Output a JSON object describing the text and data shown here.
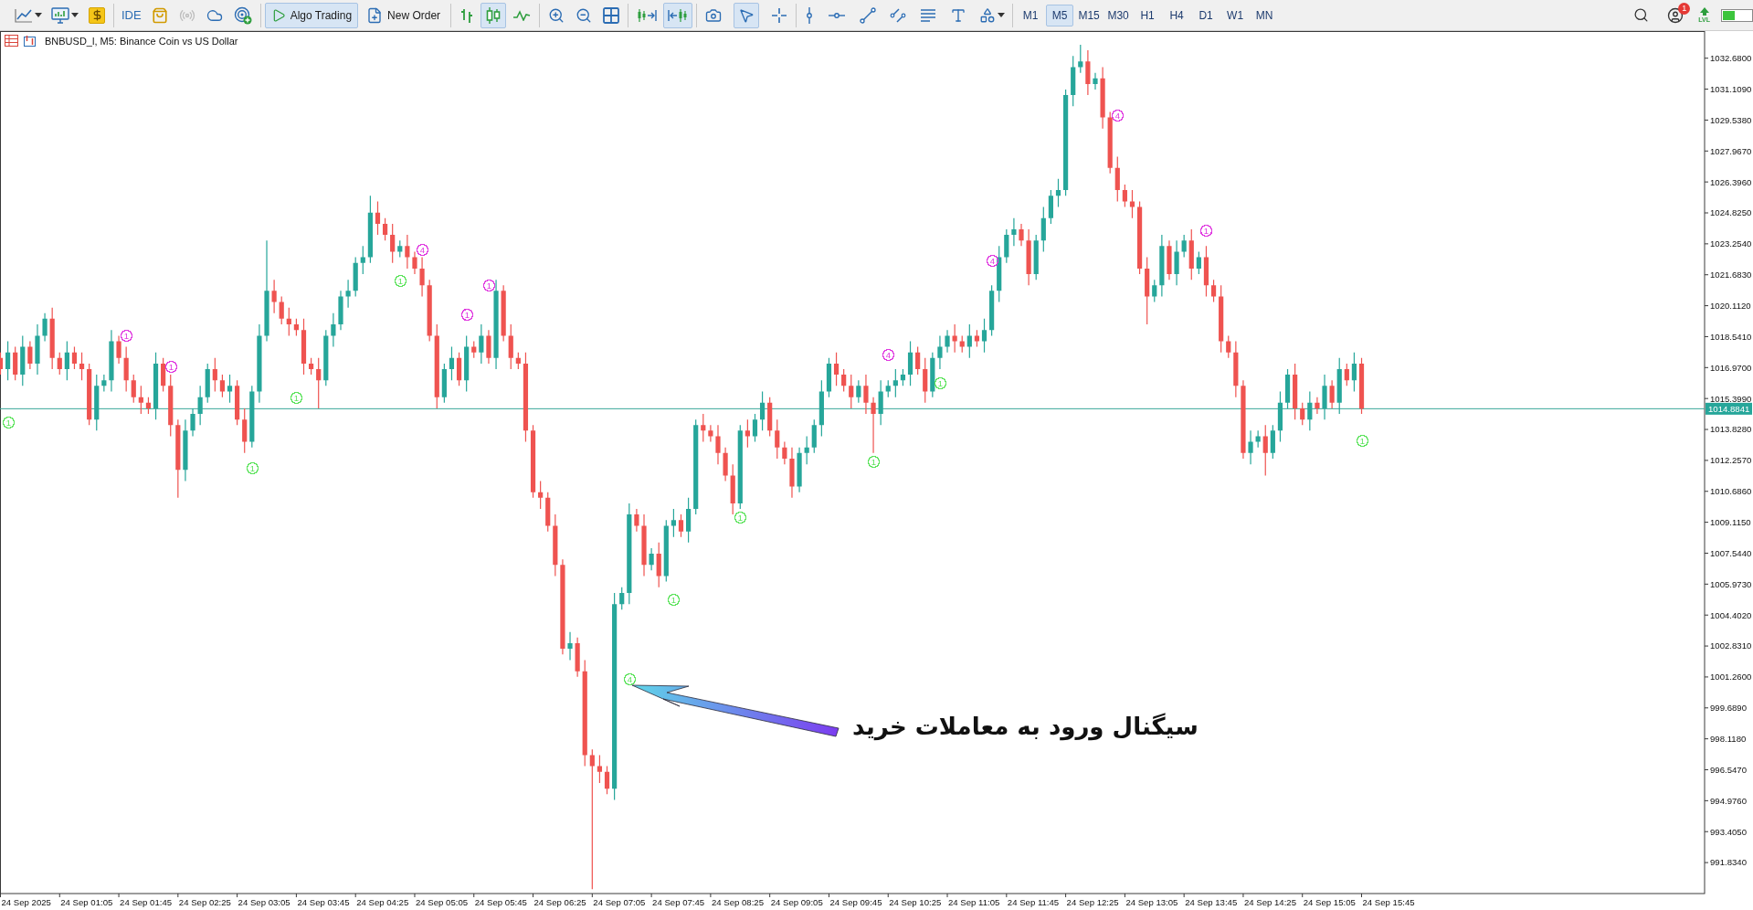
{
  "toolbar": {
    "groups": [
      [
        {
          "kind": "menu",
          "selected": false
        },
        {
          "kind": "menu",
          "selected": false
        },
        {
          "kind": "icon",
          "selected": false
        }
      ],
      [
        {
          "kind": "text",
          "label": "IDE",
          "selected": false,
          "disabled": false
        },
        {
          "kind": "icon",
          "selected": false,
          "disabled": false
        },
        {
          "kind": "icon",
          "selected": false,
          "disabled": true
        },
        {
          "kind": "icon",
          "selected": false,
          "disabled": false
        },
        {
          "kind": "icon",
          "selected": false,
          "disabled": false
        }
      ],
      [
        {
          "kind": "labeled",
          "label": "Algo Trading",
          "selected": true
        },
        {
          "kind": "labeled",
          "label": "New Order",
          "selected": false
        }
      ],
      [
        {
          "kind": "icon",
          "selected": false
        },
        {
          "kind": "icon",
          "selected": true
        },
        {
          "kind": "icon",
          "selected": false
        }
      ],
      [
        {
          "kind": "icon",
          "selected": false
        },
        {
          "kind": "icon",
          "selected": false
        },
        {
          "kind": "icon",
          "selected": false
        }
      ],
      [
        {
          "kind": "icon",
          "selected": false
        },
        {
          "kind": "icon",
          "selected": true
        }
      ],
      [
        {
          "kind": "icon",
          "selected": false
        },
        {
          "kind": "icon",
          "selected": true
        },
        {
          "kind": "icon",
          "selected": false
        }
      ],
      [
        {
          "kind": "icon",
          "selected": false
        },
        {
          "kind": "icon",
          "selected": false
        },
        {
          "kind": "icon",
          "selected": false
        },
        {
          "kind": "icon",
          "selected": false
        },
        {
          "kind": "icon",
          "selected": false
        },
        {
          "kind": "icon",
          "selected": false
        },
        {
          "kind": "menu",
          "selected": false
        }
      ]
    ],
    "timeframes": [
      {
        "label": "M1",
        "selected": false
      },
      {
        "label": "M5",
        "selected": true
      },
      {
        "label": "M15",
        "selected": false
      },
      {
        "label": "M30",
        "selected": false
      },
      {
        "label": "H1",
        "selected": false
      },
      {
        "label": "H4",
        "selected": false
      },
      {
        "label": "D1",
        "selected": false
      },
      {
        "label": "W1",
        "selected": false
      },
      {
        "label": "MN",
        "selected": false
      }
    ],
    "status": {
      "badge": "1",
      "indicator_label": "LVL"
    }
  },
  "chart": {
    "header": "BNBUSD_l, M5: Binance Coin vs US Dollar",
    "price_scale": [
      "1032.6800",
      "1031.1090",
      "1029.5380",
      "1027.9670",
      "1026.3960",
      "1024.8250",
      "1023.2540",
      "1021.6830",
      "1020.1120",
      "1018.5410",
      "1016.9700",
      "1015.3990",
      "1013.8280",
      "1012.2570",
      "1010.6860",
      "1009.1150",
      "1007.5440",
      "1005.9730",
      "1004.4020",
      "1002.8310",
      "1001.2600",
      "999.6890",
      "998.1180",
      "996.5470",
      "994.9760",
      "993.4050",
      "991.8340"
    ],
    "current_price": "1014.8841",
    "time_scale": [
      "24 Sep 2025",
      "24 Sep 01:05",
      "24 Sep 01:45",
      "24 Sep 02:25",
      "24 Sep 03:05",
      "24 Sep 03:45",
      "24 Sep 04:25",
      "24 Sep 05:05",
      "24 Sep 05:45",
      "24 Sep 06:25",
      "24 Sep 07:05",
      "24 Sep 07:45",
      "24 Sep 08:25",
      "24 Sep 09:05",
      "24 Sep 09:45",
      "24 Sep 10:25",
      "24 Sep 11:05",
      "24 Sep 11:45",
      "24 Sep 12:25",
      "24 Sep 13:05",
      "24 Sep 13:45",
      "24 Sep 14:25",
      "24 Sep 15:05",
      "24 Sep 15:45"
    ],
    "signals": [
      {
        "text": "1",
        "color": "#5de35d"
      },
      {
        "text": "1",
        "color": "#e03ae0"
      },
      {
        "text": "1",
        "color": "#e03ae0"
      },
      {
        "text": "1",
        "color": "#5de35d"
      },
      {
        "text": "1",
        "color": "#5de35d"
      },
      {
        "text": "1",
        "color": "#5de35d"
      },
      {
        "text": "4",
        "color": "#e03ae0"
      },
      {
        "text": "1",
        "color": "#e03ae0"
      },
      {
        "text": "1",
        "color": "#e03ae0"
      },
      {
        "text": "4",
        "color": "#5de35d"
      },
      {
        "text": "1",
        "color": "#5de35d"
      },
      {
        "text": "1",
        "color": "#5de35d"
      },
      {
        "text": "1",
        "color": "#5de35d"
      },
      {
        "text": "4",
        "color": "#e03ae0"
      },
      {
        "text": "1",
        "color": "#5de35d"
      },
      {
        "text": "4",
        "color": "#e03ae0"
      },
      {
        "text": "4",
        "color": "#e03ae0"
      },
      {
        "text": "1",
        "color": "#e03ae0"
      },
      {
        "text": "1",
        "color": "#5de35d"
      }
    ],
    "callout": {
      "text": "سیگنال ورود به معاملات خرید"
    }
  }
}
